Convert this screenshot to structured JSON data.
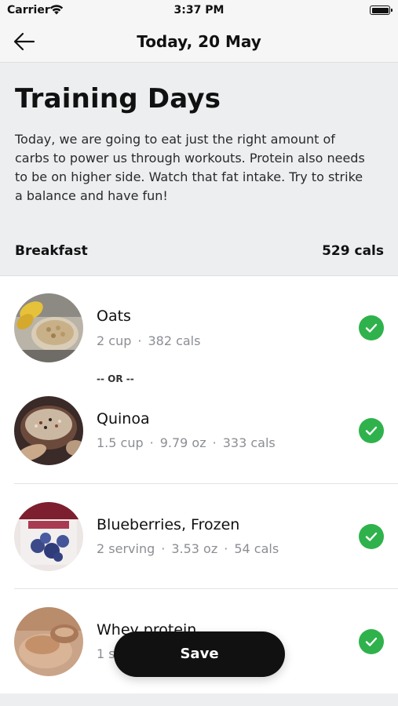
{
  "status_bar": {
    "carrier": "Carrier",
    "time": "3:37 PM"
  },
  "nav": {
    "title": "Today, 20 May"
  },
  "intro": {
    "heading": "Training Days",
    "description": "Today, we are going to eat just the right amount of carbs to power us through workouts. Protein also needs to be on higher side. Watch that fat intake. Try to strike a balance and have fun!"
  },
  "meal": {
    "name": "Breakfast",
    "calories": "529 cals"
  },
  "or_separator": "-- OR --",
  "items": [
    {
      "name": "Oats",
      "amount": "2 cup",
      "weight": "",
      "calories": "382 cals"
    },
    {
      "name": "Quinoa",
      "amount": "1.5 cup",
      "weight": "9.79 oz",
      "calories": "333 cals"
    },
    {
      "name": "Blueberries, Frozen",
      "amount": "2 serving",
      "weight": "3.53 oz",
      "calories": "54 cals"
    },
    {
      "name": "Whey protein",
      "amount": "1 s",
      "weight": "",
      "calories": ""
    }
  ],
  "save_button": {
    "label": "Save"
  },
  "colors": {
    "check_green": "#2fb24c",
    "button_black": "#111111",
    "header_gray": "#eceef0"
  }
}
